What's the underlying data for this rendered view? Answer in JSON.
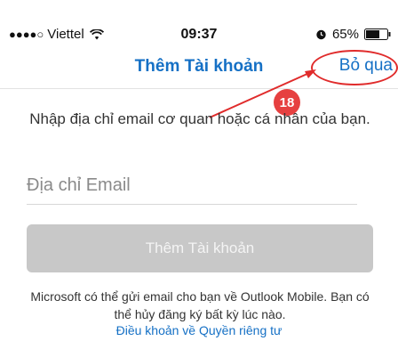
{
  "status_bar": {
    "signal_dots": "●●●●○",
    "carrier": "Viettel",
    "time": "09:37",
    "battery_percent": "65%",
    "battery_level": 0.65
  },
  "nav": {
    "title": "Thêm Tài khoản",
    "skip_label": "Bỏ qua"
  },
  "annotation": {
    "step_number": "18",
    "color": "#e02b2b"
  },
  "form": {
    "instruction": "Nhập địa chỉ email cơ quan hoặc cá nhân của bạn.",
    "email_placeholder": "Địa chỉ Email",
    "email_value": "",
    "add_account_label": "Thêm Tài khoản"
  },
  "footer": {
    "disclaimer": "Microsoft có thể gửi email cho bạn về Outlook Mobile. Bạn có thể hủy đăng ký bất kỳ lúc nào.",
    "terms_link": "Điều khoản về Quyền riêng tư"
  },
  "colors": {
    "accent": "#1570c5",
    "button_disabled": "#c8c8c8"
  },
  "icons": [
    "wifi-icon",
    "alarm-icon",
    "battery-icon"
  ]
}
